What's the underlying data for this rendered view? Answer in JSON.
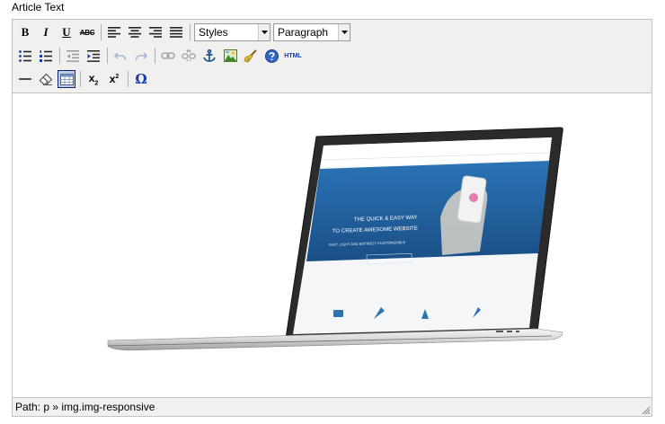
{
  "field": {
    "label": "Article Text"
  },
  "toolbar": {
    "row1": {
      "bold": "B",
      "italic": "I",
      "underline": "U",
      "strike": "ABC",
      "styles_select": "Styles",
      "format_select": "Paragraph"
    },
    "row2": {
      "html_button": "HTML"
    },
    "row3": {
      "subscript_base": "x",
      "subscript_mark": "2",
      "superscript_base": "x",
      "superscript_mark": "2",
      "charmap": "Ω"
    }
  },
  "content": {
    "image": {
      "screen": {
        "logo": "AGNES",
        "headline_1": "THE QUICK & EASY WAY",
        "headline_2": "TO CREATE AWESOME WEBSITE",
        "tagline": "FAST, LIGHT AND ENTIRELY CUSTOMIZABLE",
        "cta": "GET MORE FEATURES"
      }
    }
  },
  "statusbar": {
    "path": "Path: p » img.img-responsive"
  },
  "colors": {
    "toolbar_bg": "#f0f0ee",
    "border": "#c4c4c4",
    "icon_blue": "#1a3aa8",
    "screen_blue": "#2b6aa8"
  }
}
